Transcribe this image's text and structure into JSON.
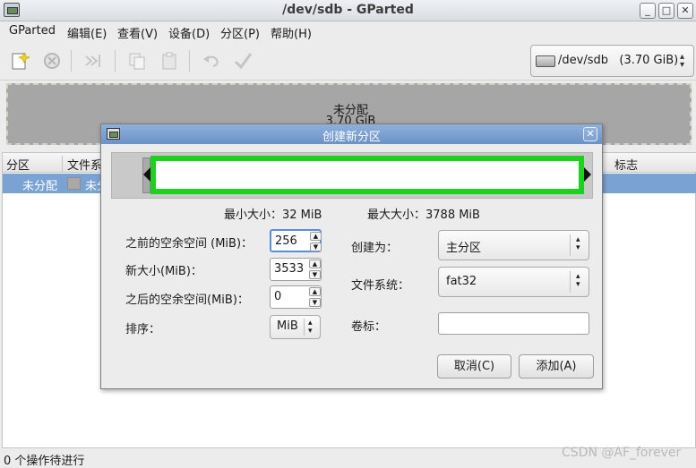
{
  "window": {
    "title": "/dev/sdb - GParted",
    "minimize": "_",
    "maximize": "□",
    "close": "✕"
  },
  "menu": [
    "GParted",
    "编辑(E)",
    "查看(V)",
    "设备(D)",
    "分区(P)",
    "帮助(H)"
  ],
  "toolbar": {
    "device": "/dev/sdb   (3.70 GiB)"
  },
  "graph": {
    "label": "未分配",
    "size": "3.70 GiB"
  },
  "list": {
    "columns": [
      "分区",
      "文件系",
      "标志"
    ],
    "row": {
      "partition": "未分配",
      "filesystem": "未分"
    }
  },
  "status": "0 个操作待进行",
  "watermark": "CSDN @AF_forever",
  "dialog": {
    "title": "创建新分区",
    "close": "✕",
    "min_size": "最小大小：32 MiB",
    "max_size": "最大大小：3788 MiB",
    "free_before_label": "之前的空余空间 (MiB)：",
    "free_before_value": "256",
    "new_size_label": "新大小(MiB)：",
    "new_size_value": "3533",
    "free_after_label": "之后的空余空间(MiB)：",
    "free_after_value": "0",
    "align_label": "排序：",
    "align_value": "MiB",
    "create_as_label": "创建为：",
    "create_as_value": "主分区",
    "filesystem_label": "文件系统：",
    "filesystem_value": "fat32",
    "volume_label": "卷标：",
    "volume_value": "",
    "cancel_button": "取消(C)",
    "add_button": "添加(A)"
  }
}
